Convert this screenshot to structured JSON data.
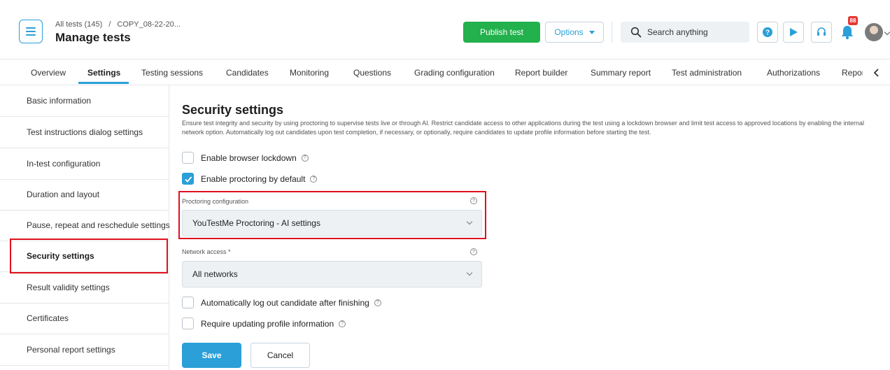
{
  "header": {
    "breadcrumb": {
      "parent": "All tests (145)",
      "separator": "/",
      "current": "COPY_08-22-20..."
    },
    "title": "Manage tests",
    "publish_label": "Publish test",
    "options_label": "Options",
    "search_placeholder": "Search anything",
    "notification_count": "88"
  },
  "tabs": [
    {
      "label": "Overview"
    },
    {
      "label": "Settings",
      "active": true
    },
    {
      "label": "Testing sessions"
    },
    {
      "label": "Candidates"
    },
    {
      "label": "Monitoring"
    },
    {
      "label": "Questions"
    },
    {
      "label": "Grading configuration"
    },
    {
      "label": "Report builder"
    },
    {
      "label": "Summary report"
    },
    {
      "label": "Test administration"
    },
    {
      "label": "Authorizations"
    },
    {
      "label": "Repor"
    }
  ],
  "sidebar": {
    "items": [
      {
        "label": "Basic information"
      },
      {
        "label": "Test instructions dialog settings"
      },
      {
        "label": "In-test configuration"
      },
      {
        "label": "Duration and layout"
      },
      {
        "label": "Pause, repeat and reschedule settings"
      },
      {
        "label": "Security settings",
        "active": true
      },
      {
        "label": "Result validity settings"
      },
      {
        "label": "Certificates"
      },
      {
        "label": "Personal report settings"
      }
    ]
  },
  "main": {
    "title": "Security settings",
    "description": "Ensure test integrity and security by using proctoring to supervise tests live or through AI. Restrict candidate access to other applications during the test using a lockdown browser and limit test access to approved locations by enabling the internal network option. Automatically log out candidates upon test completion, if necessary, or optionally, require candidates to update profile information before starting the test.",
    "browser_lockdown": {
      "label": "Enable browser lockdown",
      "checked": false
    },
    "proctoring_default": {
      "label": "Enable proctoring by default",
      "checked": true
    },
    "proctoring_config": {
      "label": "Proctoring configuration",
      "value": "YouTestMe Proctoring - AI settings"
    },
    "network_access": {
      "label": "Network access *",
      "value": "All networks"
    },
    "auto_logout": {
      "label": "Automatically log out candidate after finishing",
      "checked": false
    },
    "require_profile": {
      "label": "Require updating profile information",
      "checked": false
    },
    "save_label": "Save",
    "cancel_label": "Cancel"
  },
  "colors": {
    "accent": "#2a9fd8",
    "publish": "#22b14c",
    "highlight": "#e0101f",
    "badge": "#e53935"
  }
}
